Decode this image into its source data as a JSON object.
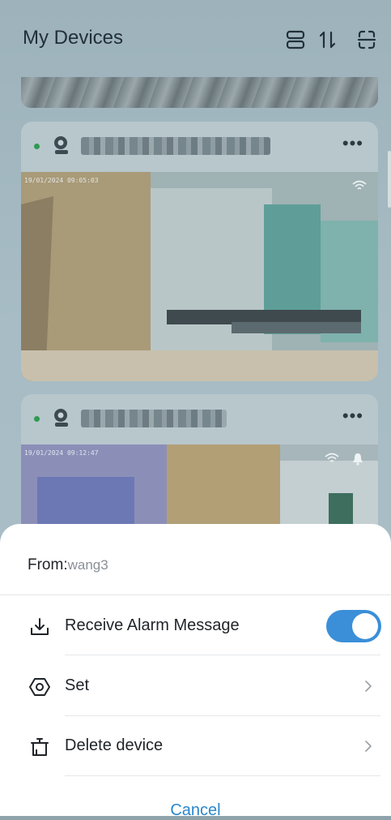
{
  "header": {
    "title": "My Devices"
  },
  "devices": [
    {
      "timestamp": "19/01/2024 09:05:03",
      "icons": [
        "wifi-icon"
      ]
    },
    {
      "timestamp": "19/01/2024 09:12:47",
      "icons": [
        "wifi-icon",
        "bell-icon"
      ]
    }
  ],
  "sheet": {
    "from_label": "From:",
    "from_user": "wang3",
    "items": [
      {
        "label": "Receive Alarm Message",
        "icon": "download-icon",
        "control": "toggle",
        "enabled": true
      },
      {
        "label": "Set",
        "icon": "settings-icon",
        "control": "chevron"
      },
      {
        "label": "Delete device",
        "icon": "trash-icon",
        "control": "chevron"
      }
    ],
    "cancel_label": "Cancel"
  },
  "colors": {
    "accent": "#2a87c9",
    "toggle_on": "#3a8fd8",
    "online": "#2f9a52"
  }
}
